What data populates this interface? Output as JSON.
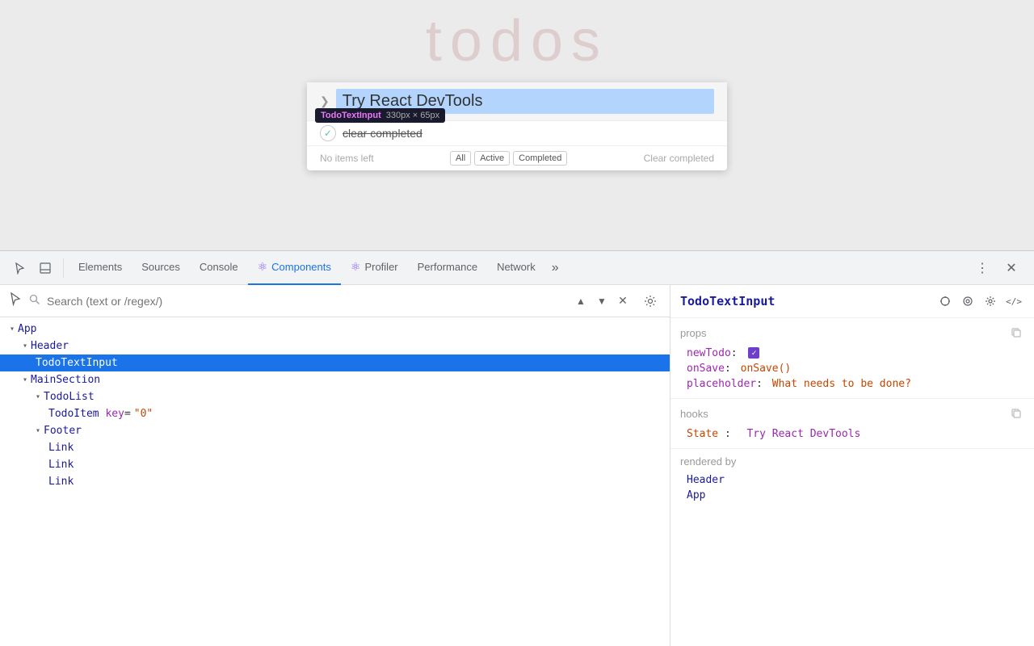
{
  "preview": {
    "title": "todos",
    "input_value": "Try React DevTools",
    "tooltip": {
      "component": "TodoTextInput",
      "size": "330px × 65px"
    },
    "todo_item": "clear completed",
    "footer_items_left": "No items left",
    "filter_all": "All",
    "filter_active": "Active",
    "filter_completed": "Completed",
    "filter_clear": "Clear completed"
  },
  "devtools": {
    "tabs": [
      {
        "label": "Elements",
        "active": false,
        "icon": ""
      },
      {
        "label": "Sources",
        "active": false,
        "icon": ""
      },
      {
        "label": "Console",
        "active": false,
        "icon": ""
      },
      {
        "label": "Components",
        "active": true,
        "icon": "⚛"
      },
      {
        "label": "Profiler",
        "active": false,
        "icon": "⚛"
      },
      {
        "label": "Performance",
        "active": false,
        "icon": ""
      },
      {
        "label": "Network",
        "active": false,
        "icon": ""
      }
    ],
    "search": {
      "placeholder": "Search (text or /regex/)"
    }
  },
  "component_tree": {
    "items": [
      {
        "depth": 0,
        "has_children": true,
        "name": "App",
        "props": "",
        "selected": false
      },
      {
        "depth": 1,
        "has_children": true,
        "name": "Header",
        "props": "",
        "selected": false
      },
      {
        "depth": 2,
        "has_children": false,
        "name": "TodoTextInput",
        "props": "",
        "selected": true
      },
      {
        "depth": 1,
        "has_children": true,
        "name": "MainSection",
        "props": "",
        "selected": false
      },
      {
        "depth": 2,
        "has_children": true,
        "name": "TodoList",
        "props": "",
        "selected": false
      },
      {
        "depth": 3,
        "has_children": false,
        "name": "TodoItem",
        "props": " key=\"0\"",
        "selected": false
      },
      {
        "depth": 2,
        "has_children": true,
        "name": "Footer",
        "props": "",
        "selected": false
      },
      {
        "depth": 3,
        "has_children": false,
        "name": "Link",
        "props": "",
        "selected": false
      },
      {
        "depth": 3,
        "has_children": false,
        "name": "Link",
        "props": "",
        "selected": false
      },
      {
        "depth": 3,
        "has_children": false,
        "name": "Link",
        "props": "",
        "selected": false
      }
    ]
  },
  "right_panel": {
    "component_name": "TodoTextInput",
    "props": {
      "label": "props",
      "items": [
        {
          "name": "newTodo",
          "colon": ":",
          "value": "checkbox",
          "type": "bool"
        },
        {
          "name": "onSave",
          "colon": ":",
          "value": "onSave()",
          "type": "func"
        },
        {
          "name": "placeholder",
          "colon": ":",
          "value": "What needs to be done?",
          "type": "str"
        }
      ]
    },
    "hooks": {
      "label": "hooks",
      "items": [
        {
          "name": "State",
          "colon": ":",
          "value": "Try React DevTools",
          "type": "str"
        }
      ]
    },
    "rendered_by": {
      "label": "rendered by",
      "items": [
        "Header",
        "App"
      ]
    }
  },
  "icons": {
    "cursor": "⬚",
    "dock": "⧉",
    "search": "🔍",
    "chevron_up": "▲",
    "chevron_down": "▼",
    "close": "✕",
    "gear": "⚙",
    "clock": "⏱",
    "eye": "👁",
    "settings": "⚙",
    "code": "</>",
    "copy": "⧉",
    "more": "⋮",
    "devtools_close": "✕"
  }
}
